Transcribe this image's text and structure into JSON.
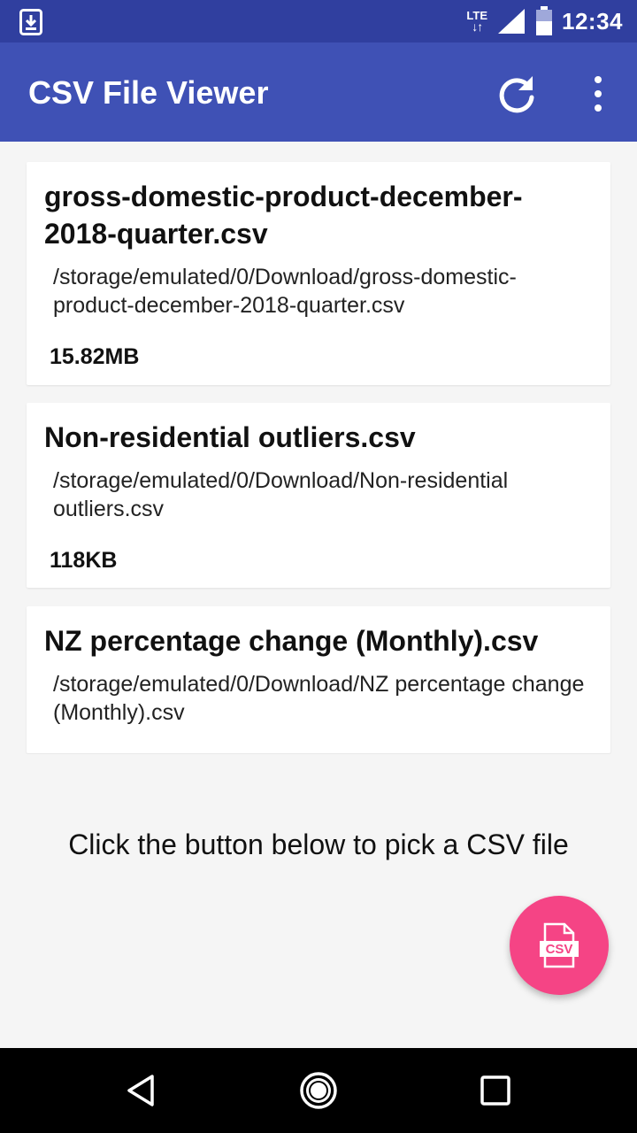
{
  "status_bar": {
    "network": "LTE",
    "time": "12:34",
    "icons": [
      "download-notification-icon",
      "signal-icon",
      "battery-icon"
    ]
  },
  "app_bar": {
    "title": "CSV File Viewer",
    "actions": [
      "refresh-icon",
      "more-vert-icon"
    ]
  },
  "files": [
    {
      "name": "gross-domestic-product-december-2018-quarter.csv",
      "path": "/storage/emulated/0/Download/gross-domestic-product-december-2018-quarter.csv",
      "size": "15.82MB"
    },
    {
      "name": "Non-residential outliers.csv",
      "path": "/storage/emulated/0/Download/Non-residential outliers.csv",
      "size": "118KB"
    },
    {
      "name": "NZ percentage change (Monthly).csv",
      "path": "/storage/emulated/0/Download/NZ percentage change (Monthly).csv",
      "size": ""
    }
  ],
  "hint": "Click the button below to pick a CSV file",
  "fab": {
    "icon": "csv-file-icon",
    "label": "CSV"
  },
  "colors": {
    "status_bar": "#303f9f",
    "app_bar": "#3f51b5",
    "fab": "#f54485",
    "background": "#f5f5f5"
  }
}
